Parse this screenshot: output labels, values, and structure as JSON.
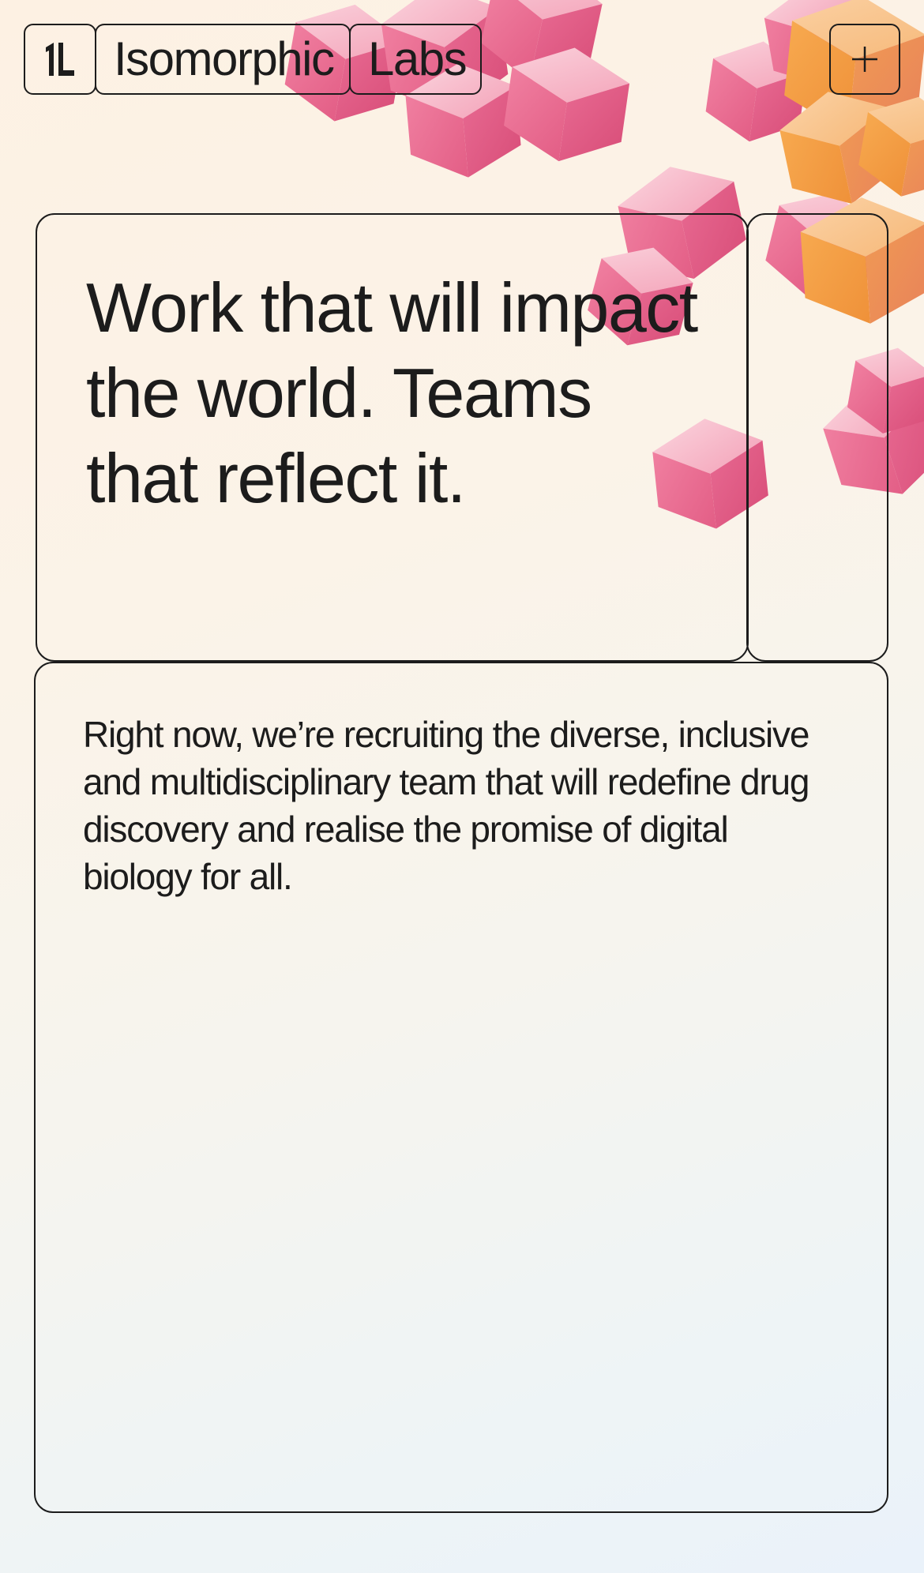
{
  "brand": {
    "logo_icon": "isomorphic-labs-logo-icon",
    "name_part1": "Isomorphic",
    "name_part2": "Labs"
  },
  "header": {
    "menu_icon": "plus-icon"
  },
  "hero": {
    "headline": "Work that will impact the world. Teams that reflect it."
  },
  "intro": {
    "body": "Right now, we’re recruiting the diverse, inclusive and multidisciplinary team that will redefine drug discovery and realise the promise of digital biology for all."
  },
  "colors": {
    "ink": "#1c1c1c",
    "cube_pink": "#e9688f",
    "cube_orange": "#f2a04e",
    "background_top": "#fdf1e3",
    "background_bottom": "#eaf2fa"
  }
}
